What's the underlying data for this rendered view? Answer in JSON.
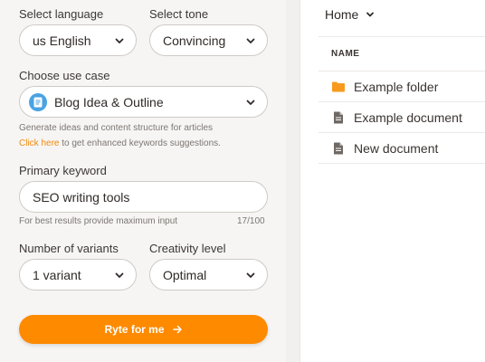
{
  "form": {
    "language": {
      "label": "Select language",
      "value": "us English"
    },
    "tone": {
      "label": "Select tone",
      "value": "Convincing"
    },
    "use_case": {
      "label": "Choose use case",
      "value": "Blog Idea & Outline",
      "description": "Generate ideas and content structure for articles",
      "link_text": "Click here",
      "link_suffix": " to get enhanced keywords suggestions."
    },
    "keyword": {
      "label": "Primary keyword",
      "value": "SEO writing tools",
      "helper": "For best results provide maximum input",
      "counter": "17/100"
    },
    "variants": {
      "label": "Number of variants",
      "value": "1 variant"
    },
    "creativity": {
      "label": "Creativity level",
      "value": "Optimal"
    },
    "submit_label": "Ryte for me"
  },
  "files": {
    "breadcrumb": "Home",
    "column_header": "NAME",
    "rows": [
      {
        "name": "Example folder",
        "icon": "folder-icon"
      },
      {
        "name": "Example document",
        "icon": "document-icon"
      },
      {
        "name": "New document",
        "icon": "document-icon"
      }
    ]
  },
  "colors": {
    "accent": "#fe8a00",
    "link": "#f08a10",
    "panel_bg": "#f6f5f4",
    "badge_blue": "#4aa3e2"
  }
}
